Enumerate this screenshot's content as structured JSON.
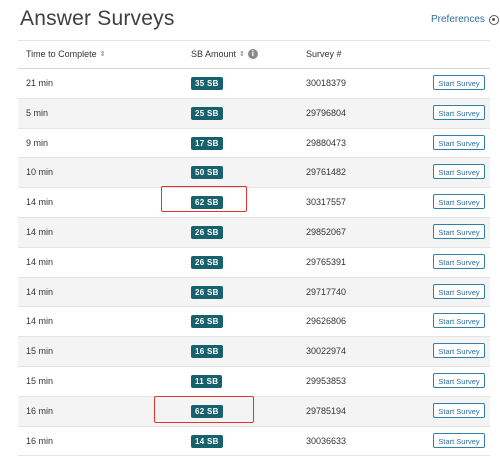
{
  "header": {
    "title": "Answer Surveys",
    "preferences": "Preferences"
  },
  "table": {
    "columns": {
      "time": "Time to Complete",
      "amount": "SB Amount",
      "survey": "Survey #"
    },
    "rows": [
      {
        "time": "21 min",
        "sb": "35 SB",
        "survey": "30018379",
        "action": "Start Survey"
      },
      {
        "time": "5 min",
        "sb": "25 SB",
        "survey": "29796804",
        "action": "Start Survey"
      },
      {
        "time": "9 min",
        "sb": "17 SB",
        "survey": "29880473",
        "action": "Start Survey"
      },
      {
        "time": "10 min",
        "sb": "50 SB",
        "survey": "29761482",
        "action": "Start Survey"
      },
      {
        "time": "14 min",
        "sb": "62 SB",
        "survey": "30317557",
        "action": "Start Survey"
      },
      {
        "time": "14 min",
        "sb": "26 SB",
        "survey": "29852067",
        "action": "Start Survey"
      },
      {
        "time": "14 min",
        "sb": "26 SB",
        "survey": "29765391",
        "action": "Start Survey"
      },
      {
        "time": "14 min",
        "sb": "26 SB",
        "survey": "29717740",
        "action": "Start Survey"
      },
      {
        "time": "14 min",
        "sb": "26 SB",
        "survey": "29626806",
        "action": "Start Survey"
      },
      {
        "time": "15 min",
        "sb": "16 SB",
        "survey": "30022974",
        "action": "Start Survey"
      },
      {
        "time": "15 min",
        "sb": "11 SB",
        "survey": "29953853",
        "action": "Start Survey"
      },
      {
        "time": "16 min",
        "sb": "62 SB",
        "survey": "29785194",
        "action": "Start Survey"
      },
      {
        "time": "16 min",
        "sb": "14 SB",
        "survey": "30036633",
        "action": "Start Survey"
      }
    ]
  },
  "colors": {
    "badge": "#17616d",
    "button_border": "#2f7fa6",
    "highlight": "#e0352c"
  }
}
